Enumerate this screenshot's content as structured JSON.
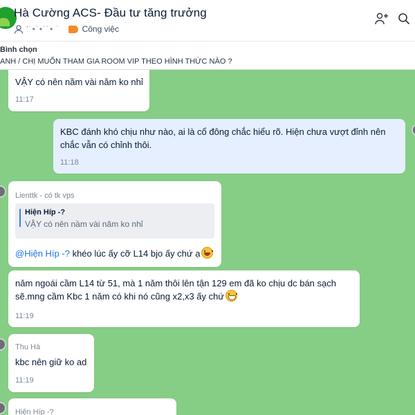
{
  "header": {
    "title": "Hà Cường ACS- Đầu tư tăng trưởng",
    "member_count_masked": "’˙•˙•˙˙• ˙",
    "label": "Công việc",
    "icons": [
      "add-member-icon",
      "search-icon"
    ]
  },
  "poll": {
    "label": "Bình chọn",
    "question": "ANH / CHỊ MUỐN THAM GIA ROOM VIP THEO HÌNH THỨC NÀO ?"
  },
  "messages": [
    {
      "text": "VẬY có nên nầm vài năm ko nhỉ",
      "time": "11:17"
    },
    {
      "text": "KBC đánh khó chịu như nào, ai là cổ đông chắc hiểu rõ. Hiện chưa vượt đỉnh nên chắc vẫn có chỉnh thôi.",
      "time": "11:18",
      "mine": true
    },
    {
      "sender": "Lienttk - có tk vps",
      "quote_name": "Hiện Híp -?",
      "quote_text": "VẬY có nên nầm vài năm ko nhỉ",
      "mention": "@Hiện Híp -?",
      "text": " khéo lúc ấy cỡ L14 bjo ấy chứ ạ",
      "emoji": "laughing-face-icon"
    },
    {
      "text": "năm ngoái cầm L14 từ 51, mà 1 năm thôi lên tận 129 em đã ko chịu dc bán sạch sẽ.mng cầm Kbc 1 năm có khi nó cũng x2,x3 ấy chứ",
      "time": "11:19",
      "emoji": "grinning-face-icon"
    },
    {
      "sender": "Thu Hà",
      "text": "kbc nên giữ ko ad",
      "time": "11:19"
    },
    {
      "sender": "Hiện Híp -?"
    }
  ],
  "colors": {
    "chat_bg": "#86cd85",
    "mine_bubble": "#e5efff",
    "link": "#1a73e8"
  }
}
